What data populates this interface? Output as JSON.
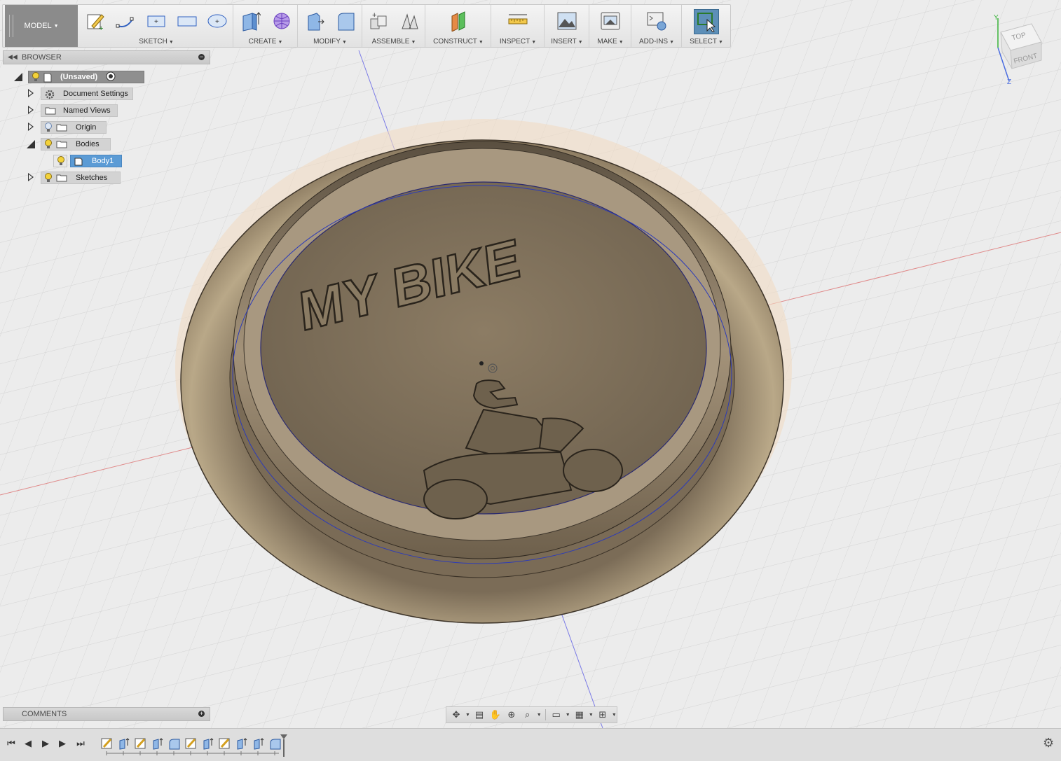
{
  "toolbar": {
    "workspace": "MODEL",
    "groups": [
      {
        "label": "SKETCH"
      },
      {
        "label": "CREATE"
      },
      {
        "label": "MODIFY"
      },
      {
        "label": "ASSEMBLE"
      },
      {
        "label": "CONSTRUCT"
      },
      {
        "label": "INSPECT"
      },
      {
        "label": "INSERT"
      },
      {
        "label": "MAKE"
      },
      {
        "label": "ADD-INS"
      },
      {
        "label": "SELECT"
      }
    ]
  },
  "browser": {
    "title": "BROWSER",
    "items": [
      {
        "label": "(Unsaved)",
        "icon": "document-icon"
      },
      {
        "label": "Document Settings",
        "icon": "gear-icon"
      },
      {
        "label": "Named Views",
        "icon": "folder-icon"
      },
      {
        "label": "Origin",
        "icon": "folder-icon"
      },
      {
        "label": "Bodies",
        "icon": "folder-icon"
      },
      {
        "label": "Body1",
        "icon": "body-icon"
      },
      {
        "label": "Sketches",
        "icon": "folder-icon"
      }
    ]
  },
  "comments": {
    "title": "COMMENTS"
  },
  "viewcube": {
    "top": "TOP",
    "front": "FRONT",
    "axis_y": "Y",
    "axis_z": "Z"
  },
  "model": {
    "embossed_text": "MY BIKE"
  },
  "colors": {
    "selection": "#5b9bd5",
    "model": "#8a7a62",
    "x_axis": "#e07070",
    "y_axis": "#6b6bdf"
  }
}
